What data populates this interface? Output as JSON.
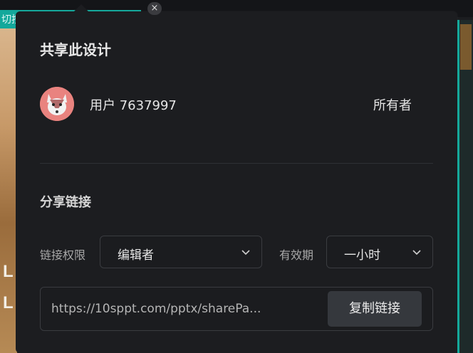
{
  "background": {
    "tab_text": "切按",
    "left_letters": [
      "L",
      "L"
    ]
  },
  "dialog": {
    "close_glyph": "×",
    "title": "共享此设计",
    "user": {
      "name": "用户 7637997",
      "role": "所有者"
    },
    "share_link": {
      "section_title": "分享链接",
      "permission_label": "链接权限",
      "permission_value": "编辑者",
      "validity_label": "有效期",
      "validity_value": "一小时",
      "url": "https://10sppt.com/pptx/sharePa...",
      "copy_button": "复制链接"
    }
  },
  "colors": {
    "accent_teal": "#13a89b",
    "popup_bg": "#1c1d20",
    "avatar_bg": "#e9837f"
  },
  "icons": {
    "close": "close-icon",
    "chevron": "chevron-down-icon",
    "avatar": "fox-avatar-icon"
  }
}
